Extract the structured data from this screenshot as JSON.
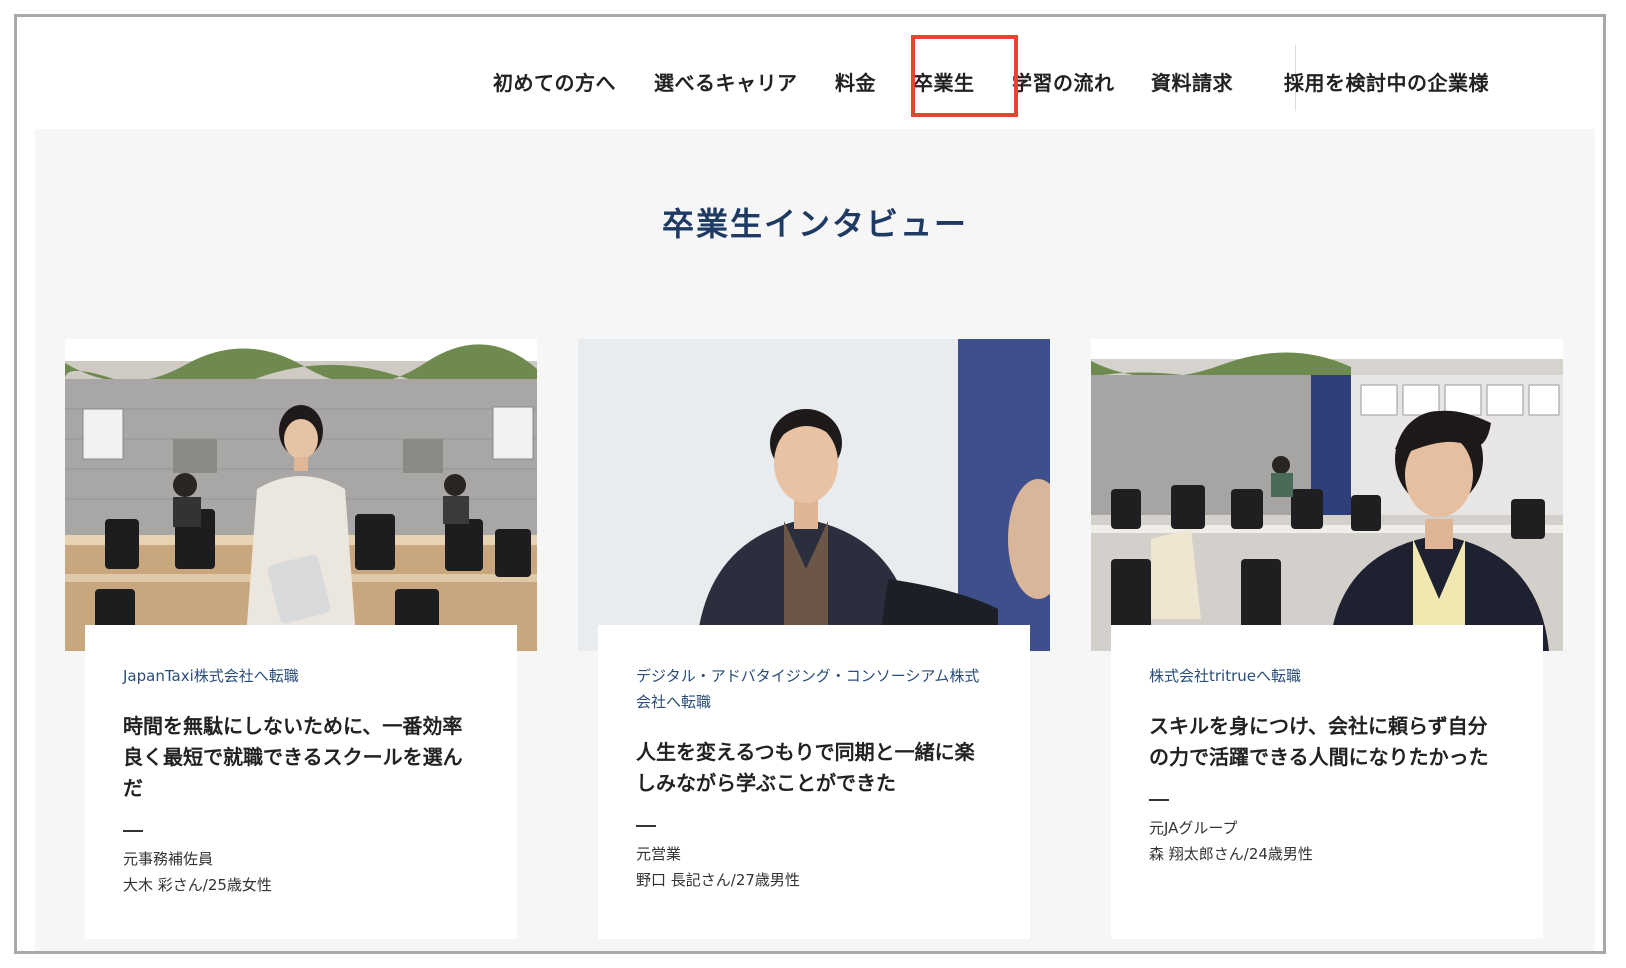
{
  "nav": {
    "items": [
      {
        "label": "初めての方へ"
      },
      {
        "label": "選べるキャリア"
      },
      {
        "label": "料金"
      },
      {
        "label": "卒業生"
      },
      {
        "label": "学習の流れ"
      },
      {
        "label": "資料請求"
      }
    ],
    "corporate": "採用を検討中の企業様"
  },
  "colors": {
    "highlight": "#e64532",
    "title": "#1f3a63",
    "section_bg": "#f6f6f7"
  },
  "section": {
    "title": "卒業生インタビュー"
  },
  "cards": [
    {
      "company": "JapanTaxi株式会社へ転職",
      "headline": "時間を無駄にしないために、一番効率良く最短で就職できるスクールを選んだ",
      "dash": "—",
      "previous": "元事務補佐員",
      "person": "大木 彩さん/25歳女性"
    },
    {
      "company": "デジタル・アドバタイジング・コンソーシアム株式会社へ転職",
      "headline": "人生を変えるつもりで同期と一緒に楽しみながら学ぶことができた",
      "dash": "—",
      "previous": "元営業",
      "person": "野口 長記さん/27歳男性"
    },
    {
      "company": "株式会社tritrueへ転職",
      "headline": "スキルを身につけ、会社に頼らず自分の力で活躍できる人間になりたかった",
      "dash": "—",
      "previous": "元JAグループ",
      "person": "森 翔太郎さん/24歳男性"
    }
  ]
}
